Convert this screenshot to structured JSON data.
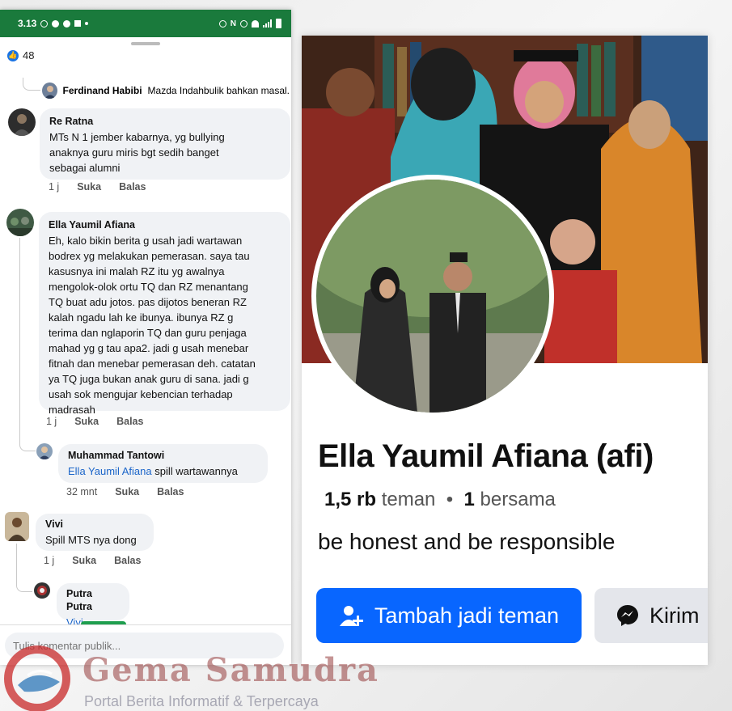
{
  "status_bar": {
    "time": "3.13"
  },
  "reactions": {
    "count": "48"
  },
  "comments": [
    {
      "author": "Ferdinand Habibi",
      "text": "Mazda Indahbulik bahkan masal.",
      "time": "",
      "like": "",
      "reply": ""
    },
    {
      "author": "Re Ratna",
      "lines": [
        "MTs N 1 jember kabarnya, yg bullying",
        "anaknya guru miris bgt sedih banget",
        "sebagai alumni"
      ],
      "time": "1 j",
      "like": "Suka",
      "reply": "Balas"
    },
    {
      "author": "Ella Yaumil Afiana",
      "lines": [
        "Eh, kalo bikin berita g usah jadi wartawan",
        "bodrex yg melakukan pemerasan. saya tau",
        "kasusnya ini malah RZ itu yg awalnya",
        "mengolok-olok ortu TQ dan RZ menantang",
        "TQ buat adu jotos. pas dijotos beneran RZ",
        "kalah ngadu lah ke ibunya. ibunya RZ g",
        "terima dan nglaporin TQ dan guru penjaga",
        "mahad yg g tau apa2. jadi g usah menebar",
        "fitnah dan menebar pemerasan deh. catatan",
        "ya TQ juga bukan anak guru di sana. jadi g",
        "usah sok mengujar kebencian terhadap",
        "madrasah"
      ],
      "time": "1 j",
      "like": "Suka",
      "reply": "Balas"
    },
    {
      "author": "Muhammad Tantowi",
      "mention": "Ella Yaumil Afiana",
      "text": "spill wartawannya",
      "time": "32 mnt",
      "like": "Suka",
      "reply": "Balas"
    },
    {
      "author": "Vivi",
      "text": "Spill MTS nya dong",
      "time": "1 j",
      "like": "Suka",
      "reply": "Balas"
    },
    {
      "author": "Putra Putra",
      "mention": "Vivi",
      "text": ""
    }
  ],
  "comment_input": {
    "placeholder": "Tulis komentar publik..."
  },
  "profile": {
    "name": "Ella Yaumil Afiana (afi)",
    "friends_count": "1,5 rb",
    "friends_label": "teman",
    "mutual_count": "1",
    "mutual_label": "bersama",
    "bio": "be honest and be responsible",
    "add_friend_label": "Tambah jadi teman",
    "message_label": "Kirim"
  },
  "watermark": {
    "title": "Gema Samudra",
    "subtitle": "Portal Berita Informatif & Terpercaya"
  },
  "colors": {
    "accent": "#0866ff",
    "status_bar": "#1a7a3c",
    "mention": "#1b65c9"
  }
}
